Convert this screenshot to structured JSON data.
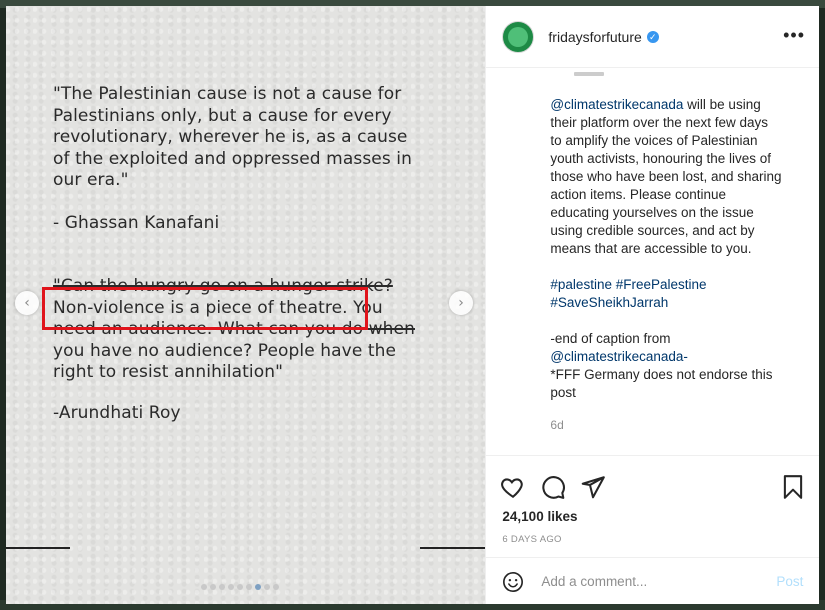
{
  "post": {
    "media": {
      "quote1_lines": [
        "\"The Palestinian cause is not a cause for",
        "Palestinians only, but a cause for every",
        "revolutionary, wherever he is, as a cause",
        "of the exploited and oppressed masses in",
        "our era.\""
      ],
      "attribution1": "- Ghassan Kanafani",
      "quote2_lines": [
        "\"Can the hungry go on a hunger strike?",
        "Non-violence is a piece of theatre. You",
        "need an audience. What can you do when",
        "you have no audience? People have the",
        "right to resist annihilation\""
      ],
      "attribution2": "-Arundhati Roy",
      "prev_icon": "chevron-left-icon",
      "next_icon": "chevron-right-icon",
      "carousel_dot_count": 9,
      "carousel_active_index": 6,
      "highlight_color": "#e0141b"
    },
    "header": {
      "username": "fridaysforfuture",
      "verified": true,
      "more_icon": "more-icon"
    },
    "caption": {
      "lines": [
        {
          "parts": [
            {
              "t": "@climatestrikecanada",
              "type": "mention"
            },
            {
              "t": " will be using",
              "type": "text"
            }
          ]
        },
        {
          "parts": [
            {
              "t": "their platform over the next few days",
              "type": "text"
            }
          ]
        },
        {
          "parts": [
            {
              "t": "to amplify the voices of Palestinian",
              "type": "text"
            }
          ]
        },
        {
          "parts": [
            {
              "t": "youth activists, honouring the lives of",
              "type": "text"
            }
          ]
        },
        {
          "parts": [
            {
              "t": "those who have been lost, and sharing",
              "type": "text"
            }
          ]
        },
        {
          "parts": [
            {
              "t": "action items. Please continue",
              "type": "text"
            }
          ]
        },
        {
          "parts": [
            {
              "t": "educating yourselves on the issue",
              "type": "text"
            }
          ]
        },
        {
          "parts": [
            {
              "t": "using credible sources, and act by",
              "type": "text"
            }
          ]
        },
        {
          "parts": [
            {
              "t": "means that are accessible to you.",
              "type": "text"
            }
          ]
        },
        {
          "parts": [
            {
              "t": "",
              "type": "text"
            }
          ]
        },
        {
          "parts": [
            {
              "t": "#palestine",
              "type": "tag"
            },
            {
              "t": " ",
              "type": "text"
            },
            {
              "t": "#FreePalestine",
              "type": "tag"
            }
          ]
        },
        {
          "parts": [
            {
              "t": "#SaveSheikhJarrah",
              "type": "tag"
            }
          ]
        },
        {
          "parts": [
            {
              "t": "",
              "type": "text"
            }
          ]
        },
        {
          "parts": [
            {
              "t": "-end of caption from",
              "type": "text"
            }
          ]
        },
        {
          "parts": [
            {
              "t": "@climatestrikecanada-",
              "type": "mention"
            }
          ]
        },
        {
          "parts": [
            {
              "t": "*FFF Germany does not endorse this",
              "type": "text"
            }
          ]
        },
        {
          "parts": [
            {
              "t": "post",
              "type": "text"
            }
          ]
        }
      ],
      "time_ago": "6d"
    },
    "actions": {
      "like_icon": "heart-icon",
      "comment_icon": "comment-icon",
      "share_icon": "share-icon",
      "save_icon": "bookmark-icon",
      "likes_text": "24,100 likes",
      "date_text": "6 DAYS AGO"
    },
    "comment": {
      "emoji_icon": "emoji-icon",
      "placeholder": "Add a comment...",
      "post_label": "Post"
    }
  }
}
